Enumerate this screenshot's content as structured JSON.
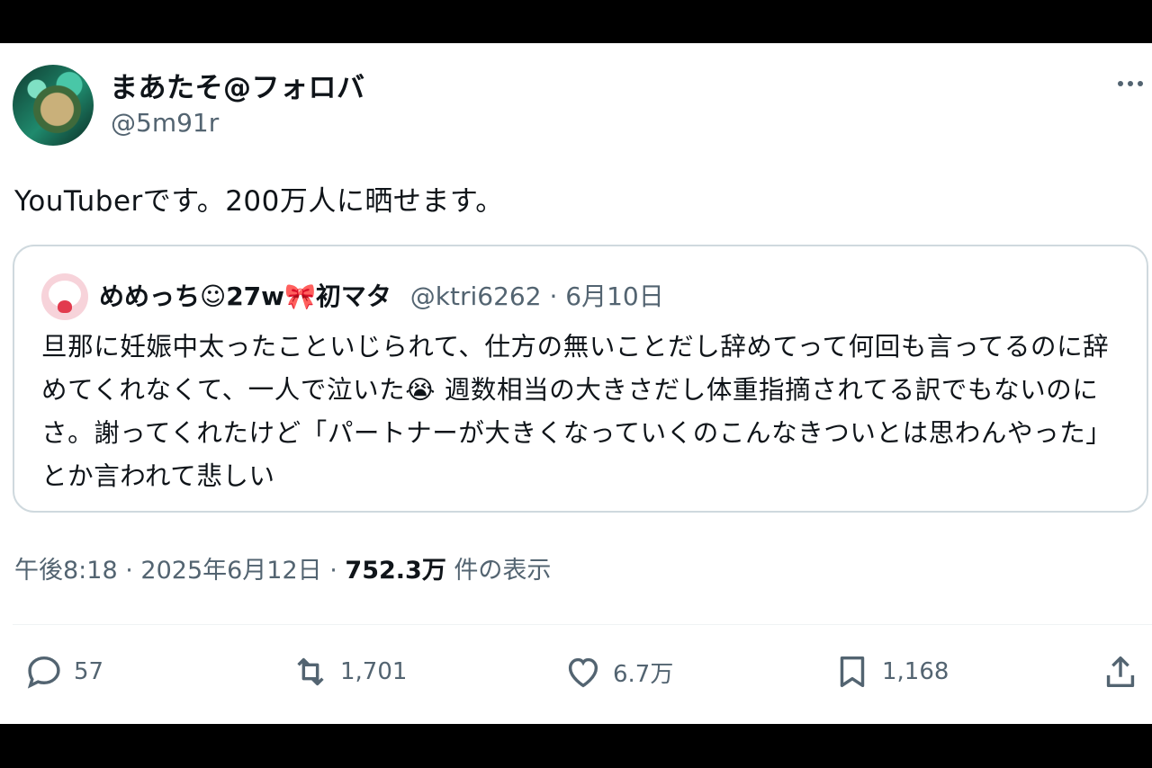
{
  "author": {
    "display_name": "まあたそ@フォロバ",
    "handle": "@5m91r"
  },
  "tweet": {
    "text": "YouTuberです。200万人に晒せます。"
  },
  "quoted": {
    "display_name": "めめっち☺27w🎀初マタ",
    "handle": "@ktri6262",
    "date": "6月10日",
    "body": "旦那に妊娠中太ったこといじられて、仕方の無いことだし辞めてって何回も言ってるのに辞めてくれなくて、一人で泣いた😭 週数相当の大きさだし体重指摘されてる訳でもないのにさ。謝ってくれたけど「パートナーが大きくなっていくのこんなきついとは思わんやった」とか言われて悲しい"
  },
  "meta": {
    "time": "午後8:18",
    "date": "2025年6月12日",
    "views": "752.3万",
    "views_label": "件の表示"
  },
  "actions": {
    "replies": "57",
    "retweets": "1,701",
    "likes": "6.7万",
    "bookmarks": "1,168"
  },
  "icons": {
    "more": "more-dots-icon",
    "reply": "reply-icon",
    "retweet": "retweet-icon",
    "like": "heart-icon",
    "bookmark": "bookmark-icon",
    "share": "share-icon"
  },
  "colors": {
    "text": "#0f1419",
    "secondary": "#536471",
    "border": "#cfd9de"
  }
}
